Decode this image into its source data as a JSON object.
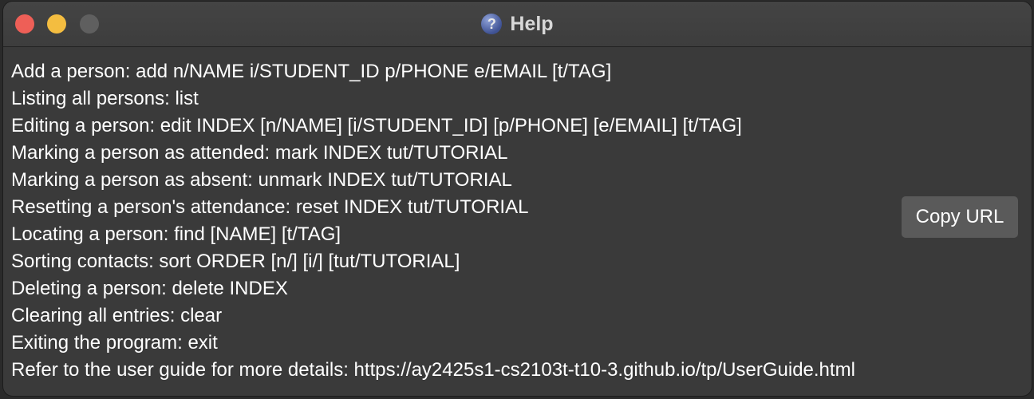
{
  "window": {
    "title": "Help",
    "title_icon": "help-question-icon"
  },
  "help": {
    "lines": [
      "Add a person: add n/NAME i/STUDENT_ID p/PHONE e/EMAIL [t/TAG]",
      "Listing all persons: list",
      "Editing a person: edit INDEX [n/NAME] [i/STUDENT_ID] [p/PHONE] [e/EMAIL] [t/TAG]",
      "Marking a person as attended: mark INDEX tut/TUTORIAL",
      "Marking a person as absent: unmark INDEX tut/TUTORIAL",
      "Resetting a person's attendance: reset INDEX tut/TUTORIAL",
      "Locating a person: find [NAME] [t/TAG]",
      "Sorting contacts: sort ORDER [n/] [i/] [tut/TUTORIAL]",
      "Deleting a person: delete INDEX",
      "Clearing all entries: clear",
      "Exiting the program: exit",
      "Refer to the user guide for more details: https://ay2425s1-cs2103t-t10-3.github.io/tp/UserGuide.html"
    ],
    "copy_button_label": "Copy URL"
  },
  "colors": {
    "close": "#ee5f57",
    "minimize": "#f4bd40",
    "maximize_disabled": "#5f5f5f",
    "background": "#3a3a3a",
    "text": "#ffffff",
    "button": "#5a5a5a"
  }
}
